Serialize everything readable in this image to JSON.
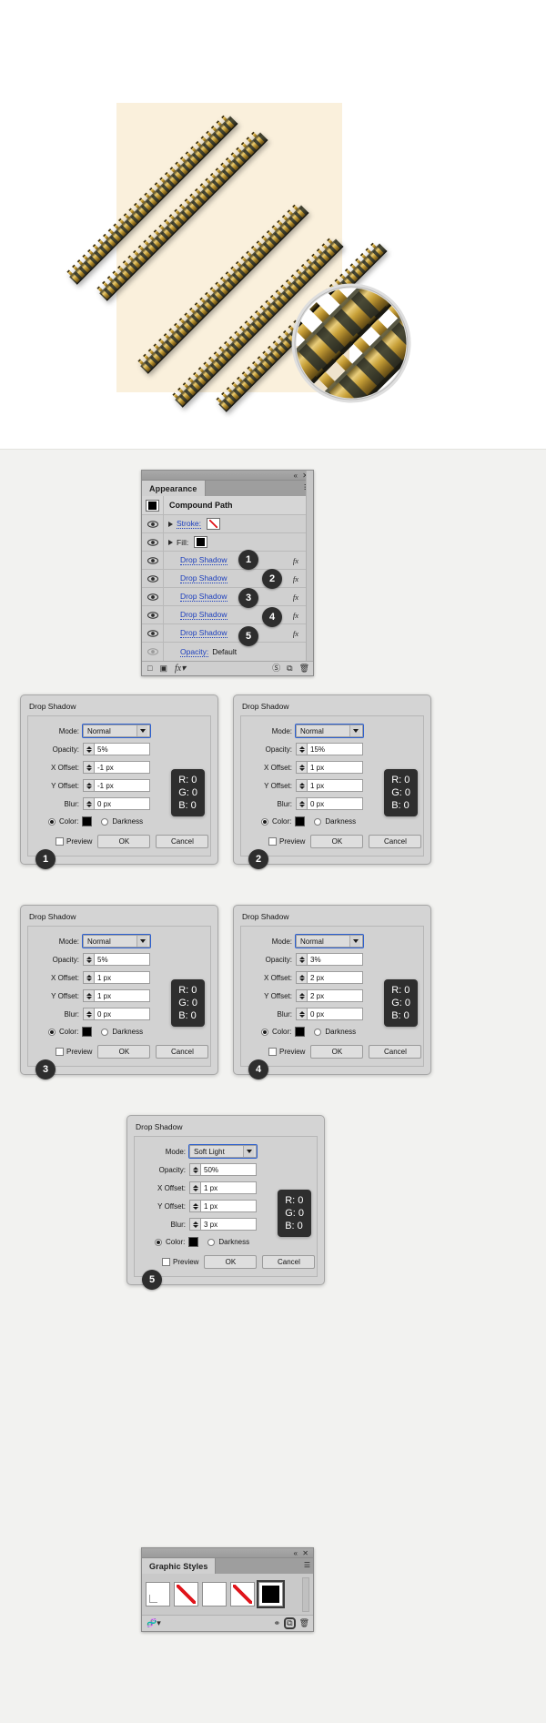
{
  "artwork": {
    "description": "Illustrator artwork of five diagonal gold pin-header connector strips over a cream square, with a circular magnifier loupe at lower right",
    "background_color": "#ffffff",
    "board_color": "#faf0dc",
    "gold_color": "#c8a13c",
    "dark_color": "#3a3a28"
  },
  "appearance_panel": {
    "tab_label": "Appearance",
    "collapse_icon": "double-chevron-left-icon",
    "close_icon": "close-icon",
    "menu_icon": "panel-menu-icon",
    "target_label": "Compound Path",
    "rows": [
      {
        "label": "Stroke:",
        "type": "stroke",
        "swatch": "stroke-none-red-slash",
        "visible": true,
        "expandable": true
      },
      {
        "label": "Fill:",
        "type": "fill",
        "swatch": "black",
        "visible": true,
        "expandable": true
      },
      {
        "label": "Drop Shadow",
        "type": "effect",
        "fx": "fx",
        "visible": true,
        "badge": "1"
      },
      {
        "label": "Drop Shadow",
        "type": "effect",
        "fx": "fx",
        "visible": true,
        "badge": "2"
      },
      {
        "label": "Drop Shadow",
        "type": "effect",
        "fx": "fx",
        "visible": true,
        "badge": "3"
      },
      {
        "label": "Drop Shadow",
        "type": "effect",
        "fx": "fx",
        "visible": true,
        "badge": "4"
      },
      {
        "label": "Drop Shadow",
        "type": "effect",
        "fx": "fx",
        "visible": true,
        "badge": "5"
      }
    ],
    "opacity_row": {
      "label": "Opacity:",
      "value": "Default",
      "visible": false
    },
    "toolbar_icons": [
      "add-new-stroke-icon",
      "add-new-fill-icon",
      "add-new-effect-fx-icon",
      "clear-appearance-icon",
      "duplicate-item-icon",
      "delete-item-icon"
    ]
  },
  "dialogs": [
    {
      "badge": "1",
      "title": "Drop Shadow",
      "labels": {
        "mode": "Mode:",
        "opacity": "Opacity:",
        "x_offset": "X Offset:",
        "y_offset": "Y Offset:",
        "blur": "Blur:",
        "color": "Color:",
        "darkness": "Darkness",
        "preview": "Preview",
        "ok": "OK",
        "cancel": "Cancel"
      },
      "mode": "Normal",
      "opacity": "5%",
      "x_offset": "-1 px",
      "y_offset": "-1 px",
      "blur": "0 px",
      "color_selected": true,
      "rgb": {
        "r": "R: 0",
        "g": "G: 0",
        "b": "B: 0"
      }
    },
    {
      "badge": "2",
      "title": "Drop Shadow",
      "labels": {
        "mode": "Mode:",
        "opacity": "Opacity:",
        "x_offset": "X Offset:",
        "y_offset": "Y Offset:",
        "blur": "Blur:",
        "color": "Color:",
        "darkness": "Darkness",
        "preview": "Preview",
        "ok": "OK",
        "cancel": "Cancel"
      },
      "mode": "Normal",
      "opacity": "15%",
      "x_offset": "1 px",
      "y_offset": "1 px",
      "blur": "0 px",
      "color_selected": true,
      "rgb": {
        "r": "R: 0",
        "g": "G: 0",
        "b": "B: 0"
      }
    },
    {
      "badge": "3",
      "title": "Drop Shadow",
      "labels": {
        "mode": "Mode:",
        "opacity": "Opacity:",
        "x_offset": "X Offset:",
        "y_offset": "Y Offset:",
        "blur": "Blur:",
        "color": "Color:",
        "darkness": "Darkness",
        "preview": "Preview",
        "ok": "OK",
        "cancel": "Cancel"
      },
      "mode": "Normal",
      "opacity": "5%",
      "x_offset": "1 px",
      "y_offset": "1 px",
      "blur": "0 px",
      "color_selected": true,
      "rgb": {
        "r": "R: 0",
        "g": "G: 0",
        "b": "B: 0"
      }
    },
    {
      "badge": "4",
      "title": "Drop Shadow",
      "labels": {
        "mode": "Mode:",
        "opacity": "Opacity:",
        "x_offset": "X Offset:",
        "y_offset": "Y Offset:",
        "blur": "Blur:",
        "color": "Color:",
        "darkness": "Darkness",
        "preview": "Preview",
        "ok": "OK",
        "cancel": "Cancel"
      },
      "mode": "Normal",
      "opacity": "3%",
      "x_offset": "2 px",
      "y_offset": "2 px",
      "blur": "0 px",
      "color_selected": true,
      "rgb": {
        "r": "R: 0",
        "g": "G: 0",
        "b": "B: 0"
      }
    },
    {
      "badge": "5",
      "title": "Drop Shadow",
      "labels": {
        "mode": "Mode:",
        "opacity": "Opacity:",
        "x_offset": "X Offset:",
        "y_offset": "Y Offset:",
        "blur": "Blur:",
        "color": "Color:",
        "darkness": "Darkness",
        "preview": "Preview",
        "ok": "OK",
        "cancel": "Cancel"
      },
      "mode": "Soft Light",
      "opacity": "50%",
      "x_offset": "1 px",
      "y_offset": "1 px",
      "blur": "3 px",
      "color_selected": true,
      "rgb": {
        "r": "R: 0",
        "g": "G: 0",
        "b": "B: 0"
      }
    }
  ],
  "graphic_styles_panel": {
    "tab_label": "Graphic Styles",
    "collapse_icon": "double-chevron-left-icon",
    "close_icon": "close-icon",
    "menu_icon": "panel-menu-icon",
    "thumbnails": [
      {
        "name": "default-none-style",
        "kind": "none"
      },
      {
        "name": "white-style",
        "kind": "white"
      },
      {
        "name": "none-slash-style",
        "kind": "none"
      },
      {
        "name": "black-fill-style",
        "kind": "black",
        "selected": true
      }
    ],
    "toolbar_icons": [
      "graphic-styles-libraries-icon",
      "break-link-to-style-icon",
      "new-graphic-style-icon",
      "delete-graphic-style-icon"
    ],
    "highlighted_toolbar_icon": "new-graphic-style-icon"
  }
}
